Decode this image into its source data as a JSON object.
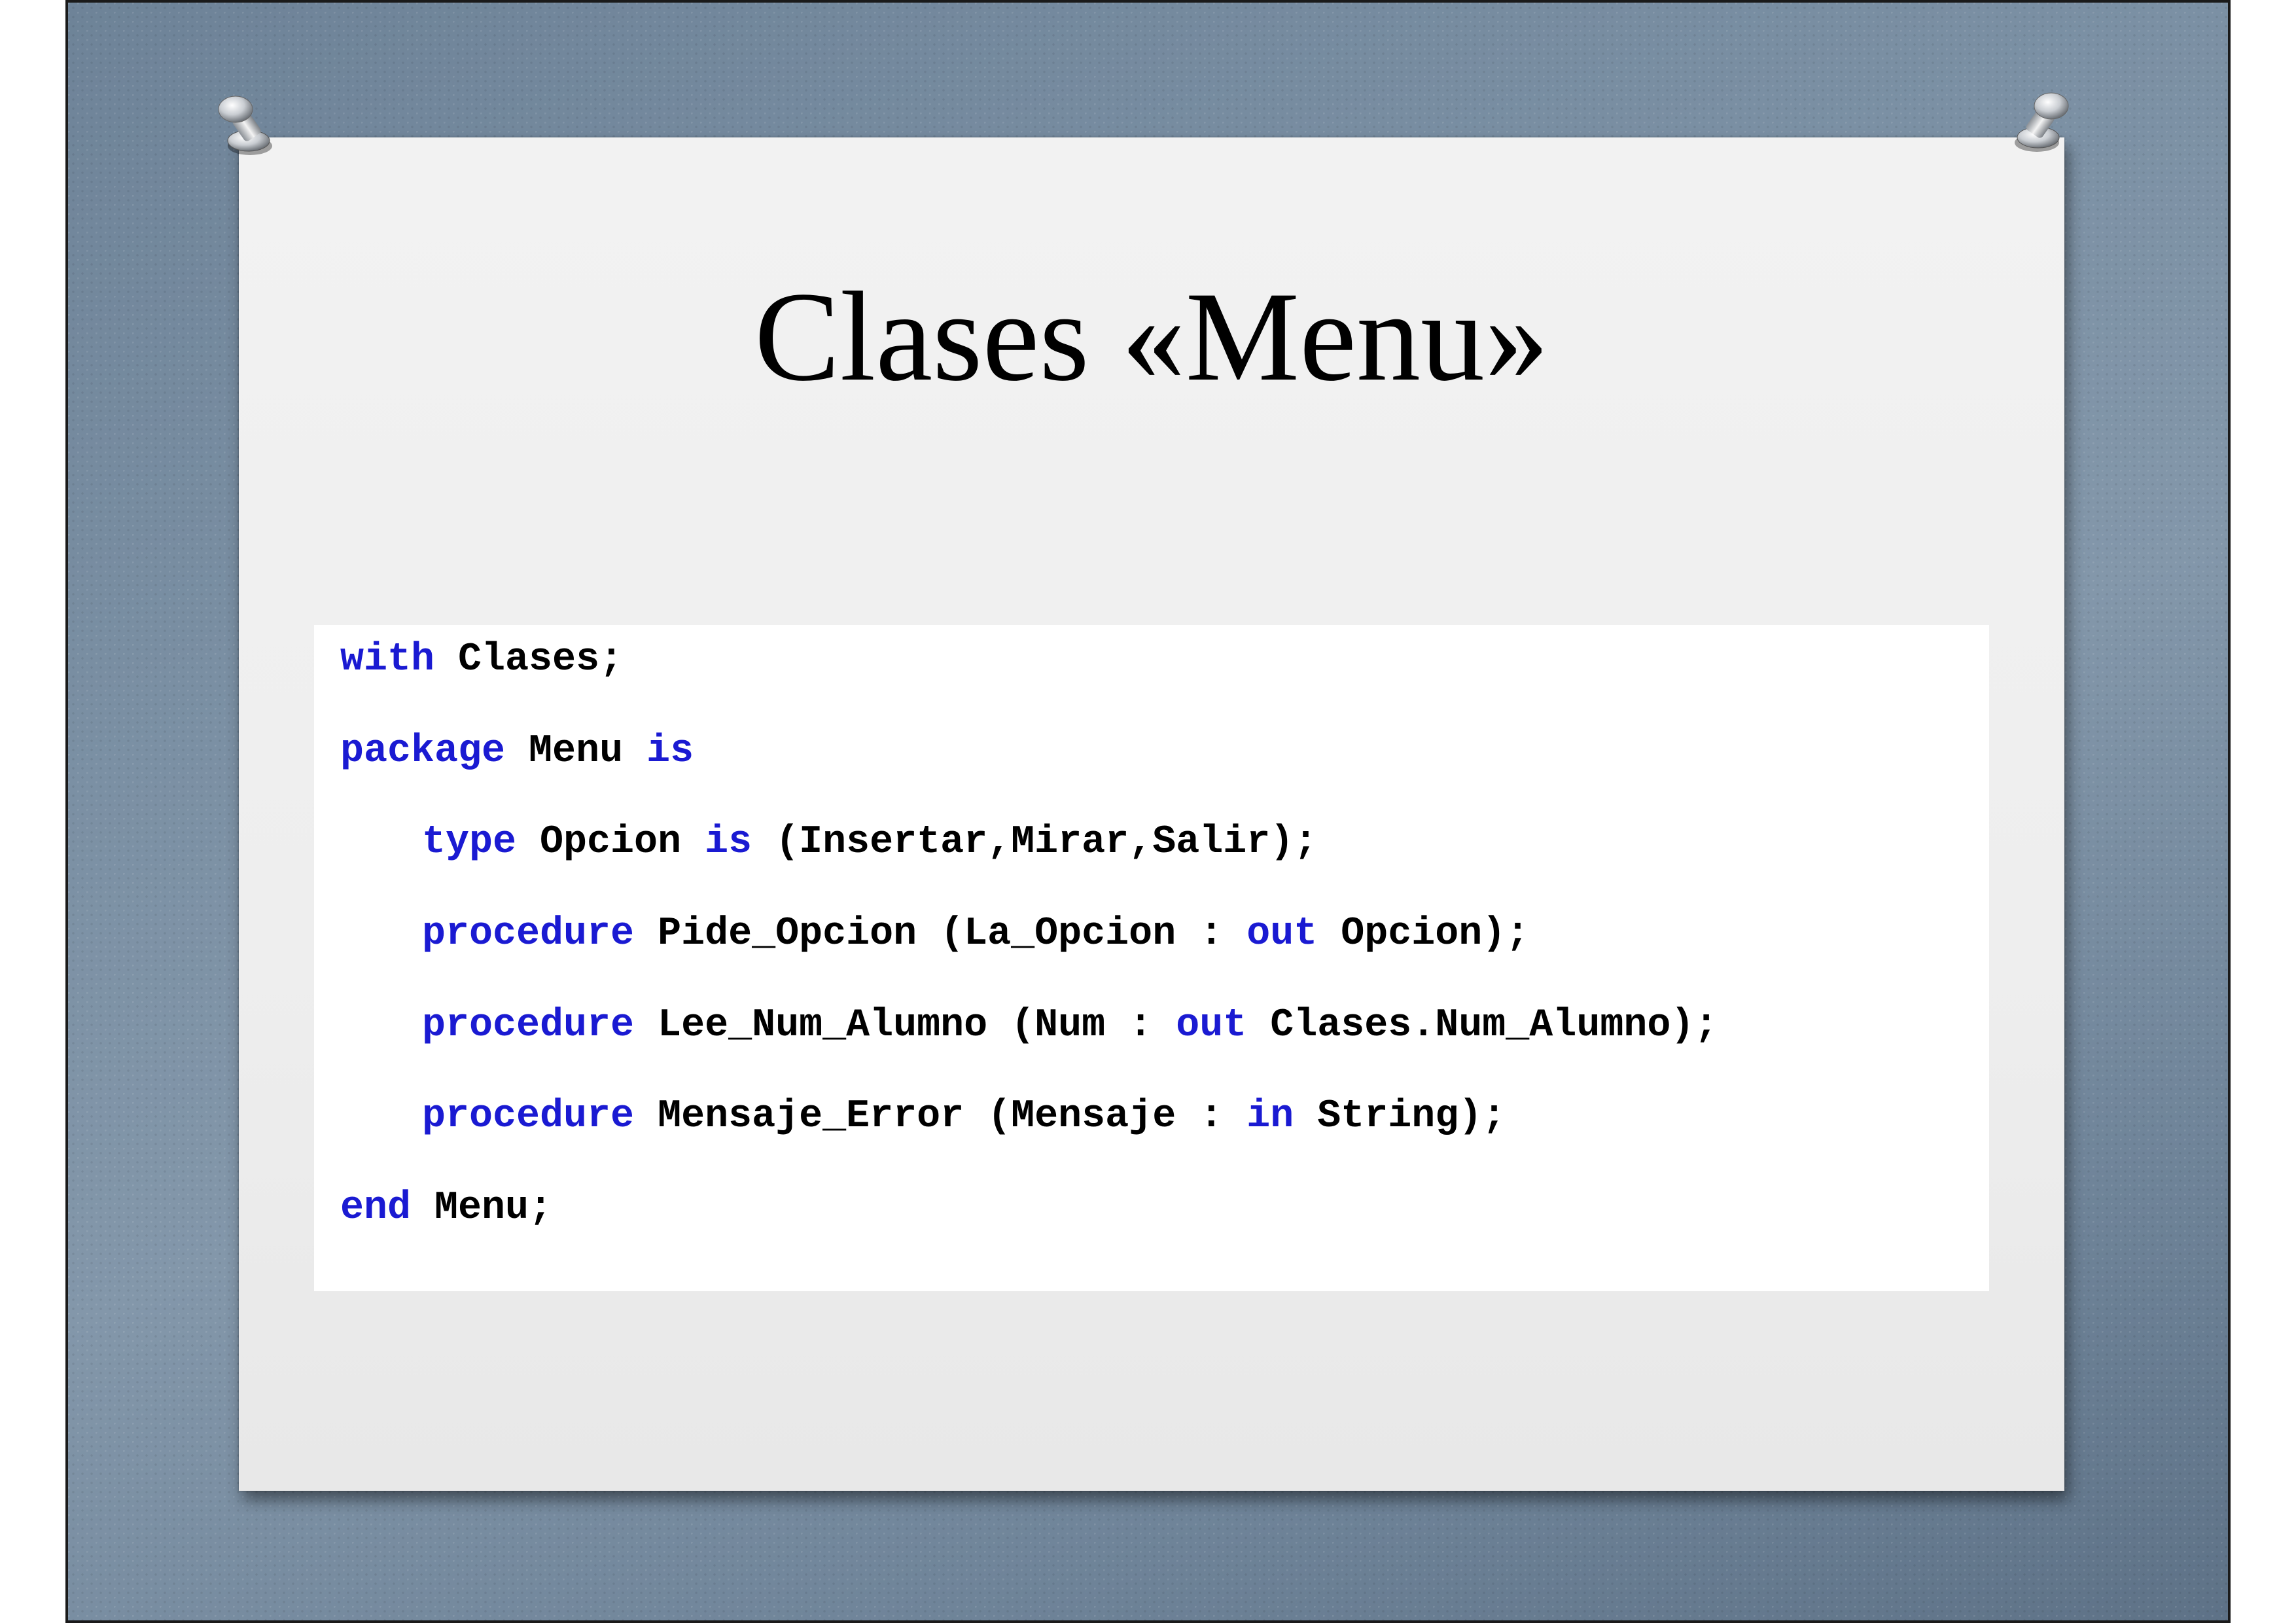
{
  "slide": {
    "title": "Clases «Menu»"
  },
  "code": {
    "lines": [
      {
        "kw1": "with",
        "text1": " Clases;"
      },
      {
        "kw1": "package",
        "text1": " Menu ",
        "kw2": "is"
      },
      {
        "kw1": "type",
        "text1": " Opcion ",
        "kw2": "is",
        "text2": " (Insertar,Mirar,Salir);"
      },
      {
        "kw1": "procedure",
        "text1": " Pide_Opcion (La_Opcion : ",
        "kw2": "out",
        "text2": " Opcion);"
      },
      {
        "kw1": "procedure",
        "text1": " Lee_Num_Alumno (Num : ",
        "kw2": "out",
        "text2": " Clases.Num_Alumno);"
      },
      {
        "kw1": "procedure",
        "text1": " Mensaje_Error (Mensaje : ",
        "kw2": "in",
        "text2": " String);"
      },
      {
        "kw1": "end",
        "text1": " Menu;"
      }
    ]
  },
  "colors": {
    "keyword": "#1a1ad2",
    "text": "#000000",
    "background": "#7a8fa3",
    "card": "#eeeeee"
  },
  "icons": {
    "pins": [
      "pushpin-icon",
      "pushpin-icon"
    ]
  }
}
